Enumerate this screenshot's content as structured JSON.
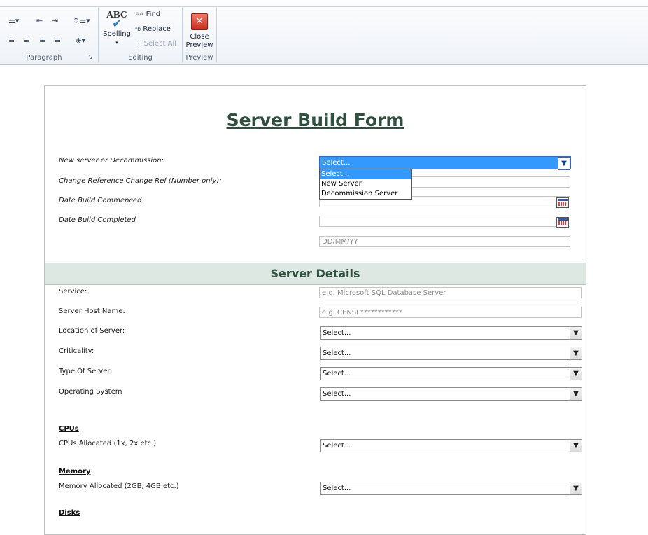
{
  "ribbon": {
    "paragraph_label": "Paragraph",
    "editing_label": "Editing",
    "preview_label": "Preview",
    "spelling_label": "Spelling",
    "spelling_icon_text": "ABC",
    "find_label": "Find",
    "replace_label": "Replace",
    "select_all_label": "Select All",
    "close_preview_line1": "Close",
    "close_preview_line2": "Preview"
  },
  "form": {
    "title": "Server Build Form",
    "fields": {
      "new_or_decom_label": "New server or Decommission:",
      "new_or_decom_value": "Select...",
      "change_ref_label": "Change Reference Change Ref (Number only):",
      "date_commenced_label": "Date Build Commenced",
      "date_completed_label": "Date Build Completed",
      "date_placeholder": "DD/MM/YY"
    },
    "dropdown_options": [
      "Select...",
      "New Server",
      "Decommission Server"
    ],
    "server_details": {
      "heading": "Server Details",
      "service_label": "Service:",
      "service_placeholder": "e.g. Microsoft SQL Database Server",
      "host_label": "Server Host Name:",
      "host_placeholder": "e.g. CENSL************",
      "location_label": "Location of Server:",
      "criticality_label": "Criticality:",
      "type_label": "Type Of Server:",
      "os_label": "Operating System",
      "select_value": "Select..."
    },
    "cpus": {
      "heading": "CPUs",
      "allocated_label": "CPUs Allocated (1x, 2x etc.)",
      "value": "Select..."
    },
    "memory": {
      "heading": "Memory",
      "allocated_label": "Memory Allocated (2GB, 4GB etc.)",
      "value": "Select..."
    },
    "disks": {
      "heading": "Disks"
    }
  }
}
